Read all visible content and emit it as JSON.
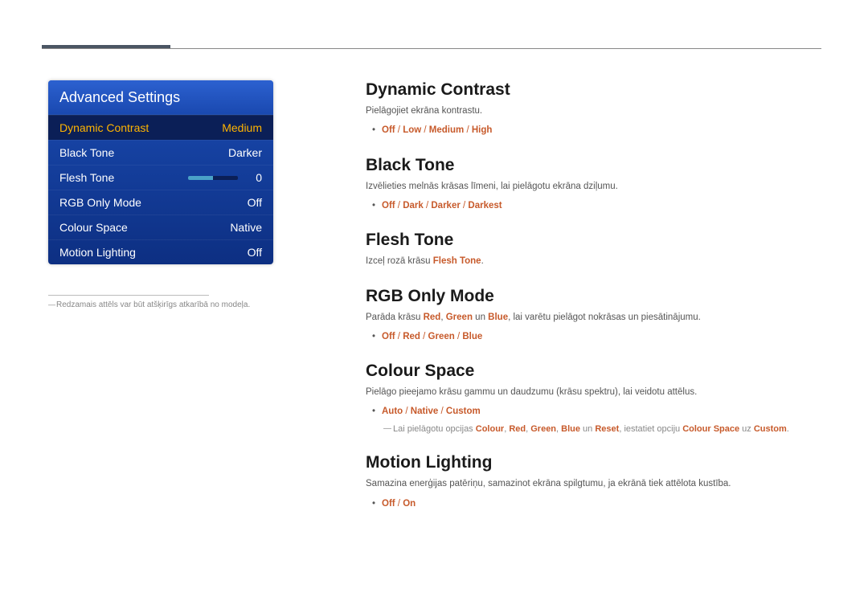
{
  "menu": {
    "title": "Advanced Settings",
    "items": [
      {
        "label": "Dynamic Contrast",
        "value": "Medium",
        "selected": true,
        "type": "text"
      },
      {
        "label": "Black Tone",
        "value": "Darker",
        "type": "text"
      },
      {
        "label": "Flesh Tone",
        "value": "0",
        "type": "slider"
      },
      {
        "label": "RGB Only Mode",
        "value": "Off",
        "type": "text"
      },
      {
        "label": "Colour Space",
        "value": "Native",
        "type": "text"
      },
      {
        "label": "Motion Lighting",
        "value": "Off",
        "type": "text"
      }
    ]
  },
  "footnote": "Redzamais attēls var būt atšķirīgs atkarībā no modeļa.",
  "sections": {
    "dynamic_contrast": {
      "heading": "Dynamic Contrast",
      "desc": "Pielāgojiet ekrāna kontrastu.",
      "options": [
        "Off",
        "Low",
        "Medium",
        "High"
      ]
    },
    "black_tone": {
      "heading": "Black Tone",
      "desc": "Izvēlieties melnās krāsas līmeni, lai pielāgotu ekrāna dziļumu.",
      "options": [
        "Off",
        "Dark",
        "Darker",
        "Darkest"
      ]
    },
    "flesh_tone": {
      "heading": "Flesh Tone",
      "desc_prefix": "Izceļ rozā krāsu ",
      "desc_hl": "Flesh Tone",
      "desc_suffix": "."
    },
    "rgb_only": {
      "heading": "RGB Only Mode",
      "desc_prefix": "Parāda krāsu ",
      "desc_r": "Red",
      "desc_sep1": ", ",
      "desc_g": "Green",
      "desc_sep2": " un ",
      "desc_b": "Blue",
      "desc_suffix": ", lai varētu pielāgot nokrāsas un piesātinājumu.",
      "options": [
        "Off",
        "Red",
        "Green",
        "Blue"
      ]
    },
    "colour_space": {
      "heading": "Colour Space",
      "desc": "Pielāgo pieejamo krāsu gammu un daudzumu (krāsu spektru), lai veidotu attēlus.",
      "options": [
        "Auto",
        "Native",
        "Custom"
      ],
      "note_p1": "Lai pielāgotu opcijas ",
      "note_colour": "Colour",
      "note_s1": ", ",
      "note_red": "Red",
      "note_s2": ", ",
      "note_green": "Green",
      "note_s3": ", ",
      "note_blue": "Blue",
      "note_s4": " un ",
      "note_reset": "Reset",
      "note_p2": ", iestatiet opciju ",
      "note_cs": "Colour Space",
      "note_p3": " uz ",
      "note_custom": "Custom",
      "note_p4": "."
    },
    "motion_lighting": {
      "heading": "Motion Lighting",
      "desc": "Samazina enerģijas patēriņu, samazinot ekrāna spilgtumu, ja ekrānā tiek attēlota kustība.",
      "options": [
        "Off",
        "On"
      ]
    }
  }
}
